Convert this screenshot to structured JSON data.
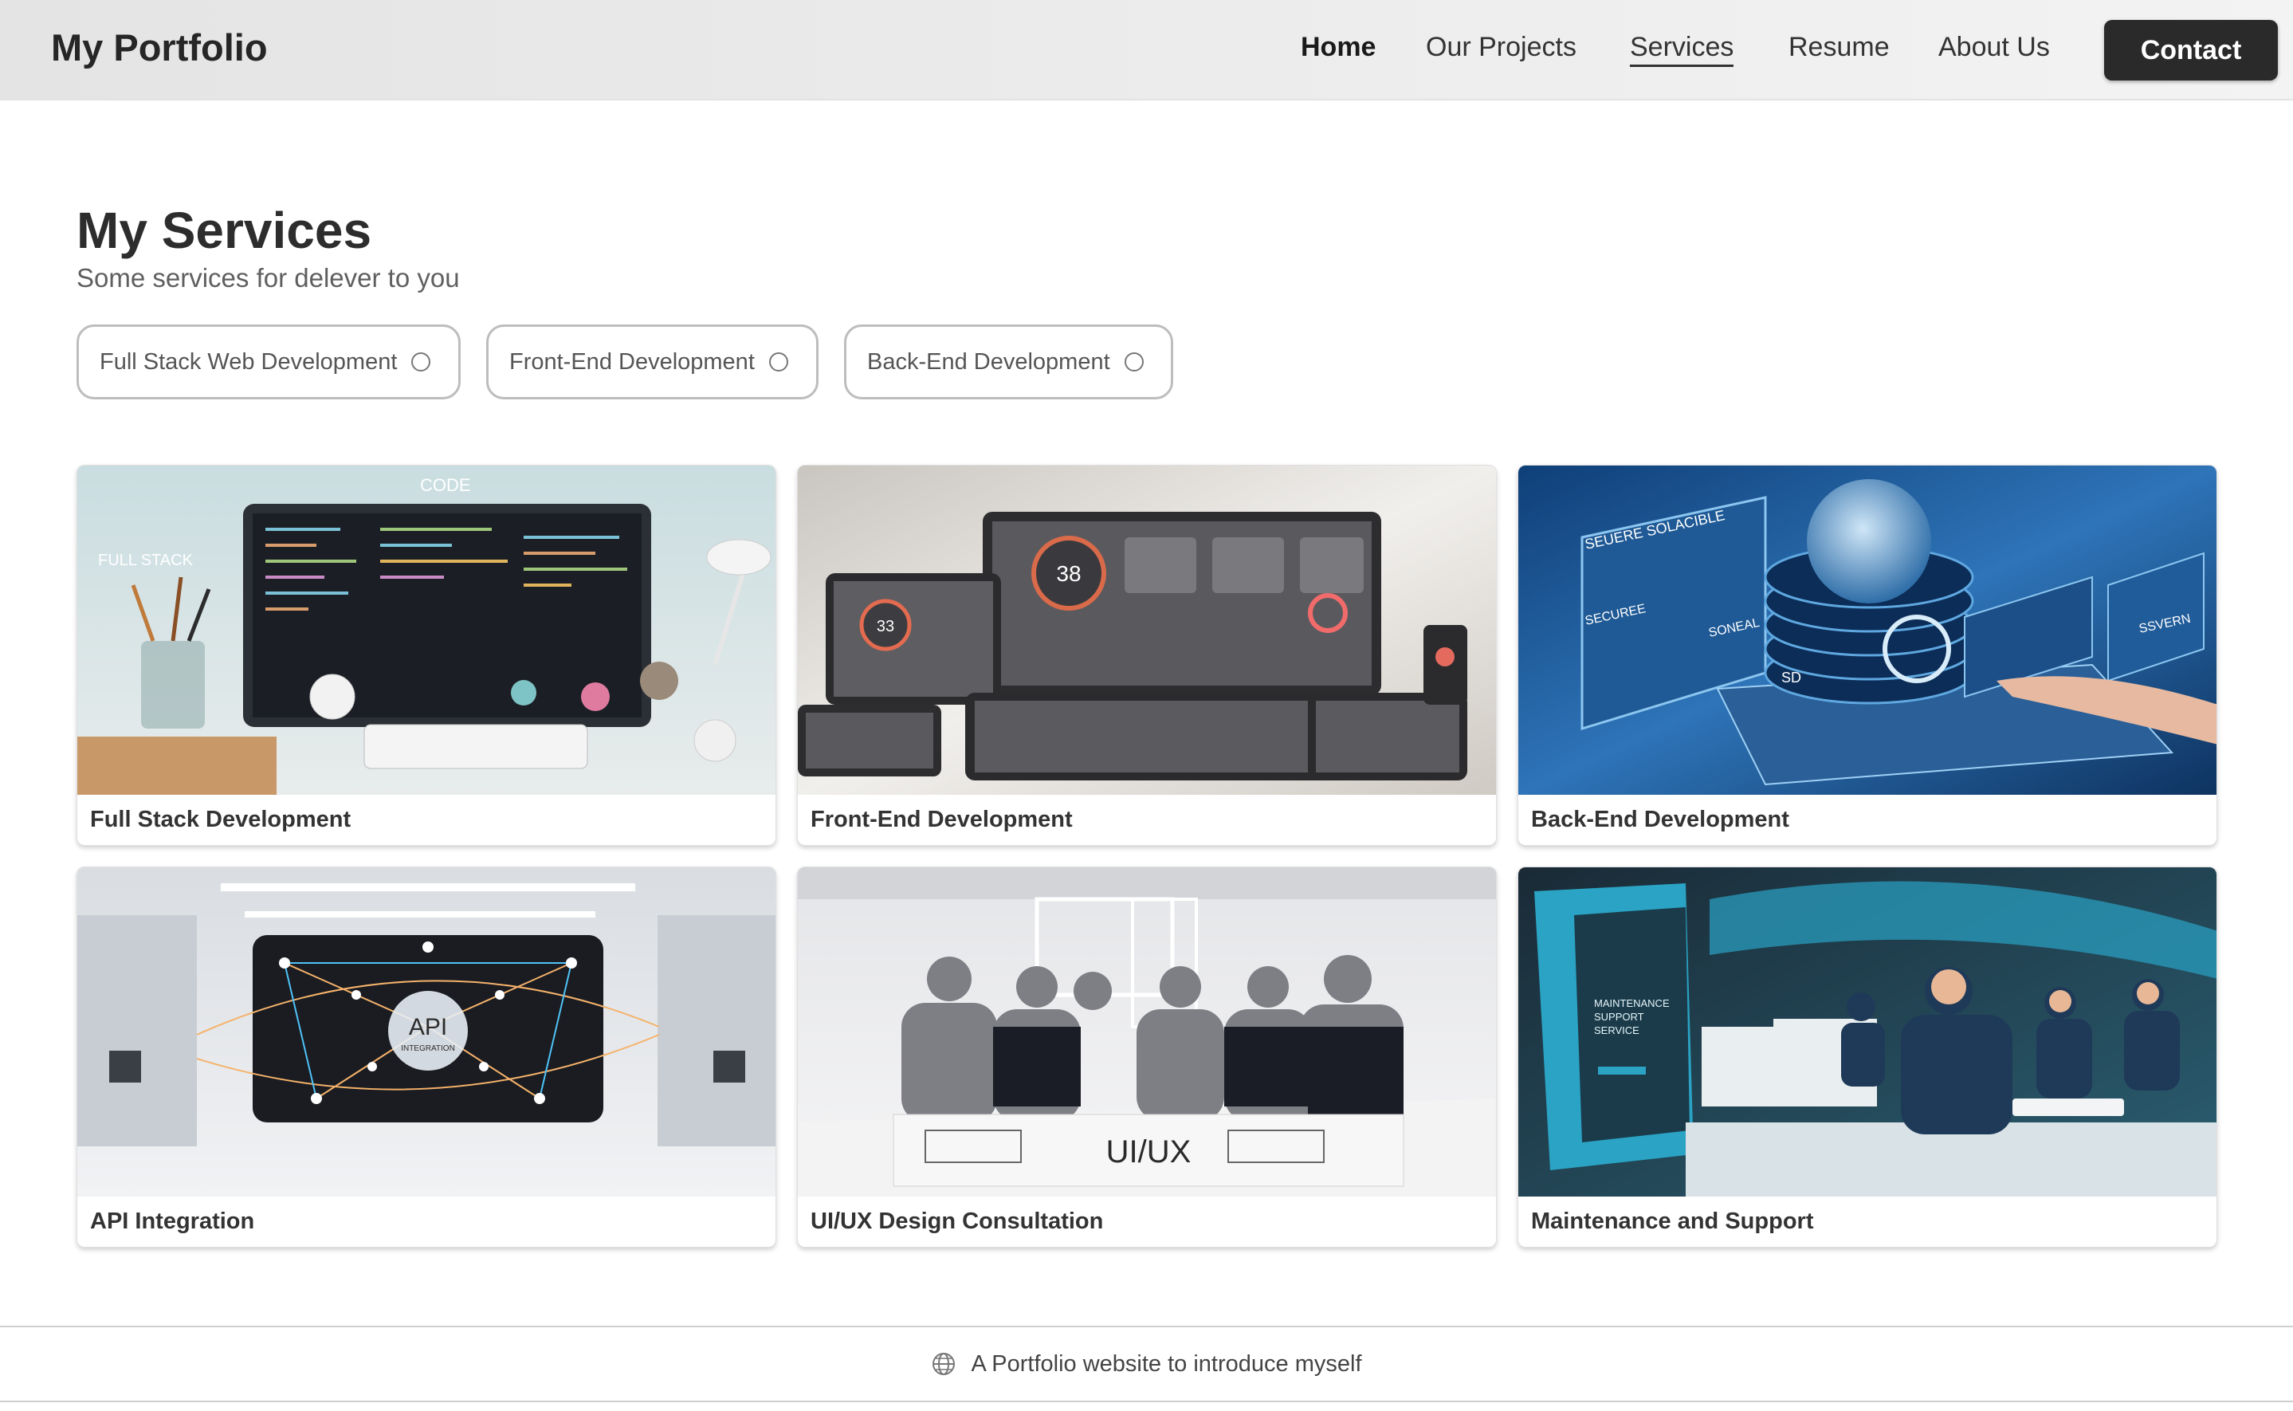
{
  "header": {
    "brand": "My Portfolio",
    "nav": [
      {
        "label": "Home"
      },
      {
        "label": "Our Projects"
      },
      {
        "label": "Services"
      },
      {
        "label": "Resume"
      },
      {
        "label": "About Us"
      }
    ],
    "active_nav": "Services",
    "contact_label": "Contact"
  },
  "main": {
    "title": "My Services",
    "subtitle": "Some services for delever to you",
    "filters": [
      {
        "label": "Full Stack Web Development",
        "selected": false
      },
      {
        "label": "Front-End Development",
        "selected": false
      },
      {
        "label": "Back-End Development",
        "selected": false
      }
    ],
    "cards": [
      {
        "label": "Full Stack Development",
        "image_text": [
          "CODE",
          "FULL STACK"
        ]
      },
      {
        "label": "Front-End Development",
        "image_text": [
          "38",
          "33"
        ]
      },
      {
        "label": "Back-End Development",
        "image_text": [
          "SEUERE SOLACIBLE",
          "SECUREE",
          "SONEAL",
          "SSVERN",
          "SD"
        ]
      },
      {
        "label": "API Integration",
        "image_text": [
          "API",
          "INTEGRATION"
        ]
      },
      {
        "label": "UI/UX Design Consultation",
        "image_text": [
          "UI/UX"
        ]
      },
      {
        "label": "Maintenance and Support",
        "image_text": [
          "MAINTENANCE",
          "SUPPORT",
          "SERVICE"
        ]
      }
    ]
  },
  "footer": {
    "icon": "globe-icon",
    "text": "A Portfolio website to introduce myself"
  },
  "colors": {
    "header_bg": "#ebebeb",
    "contact_bg": "#2a2a2a",
    "chip_border": "#bdbdbd",
    "backend_blue": "#1e5a9a",
    "maintenance_teal": "#2aa3c4"
  }
}
